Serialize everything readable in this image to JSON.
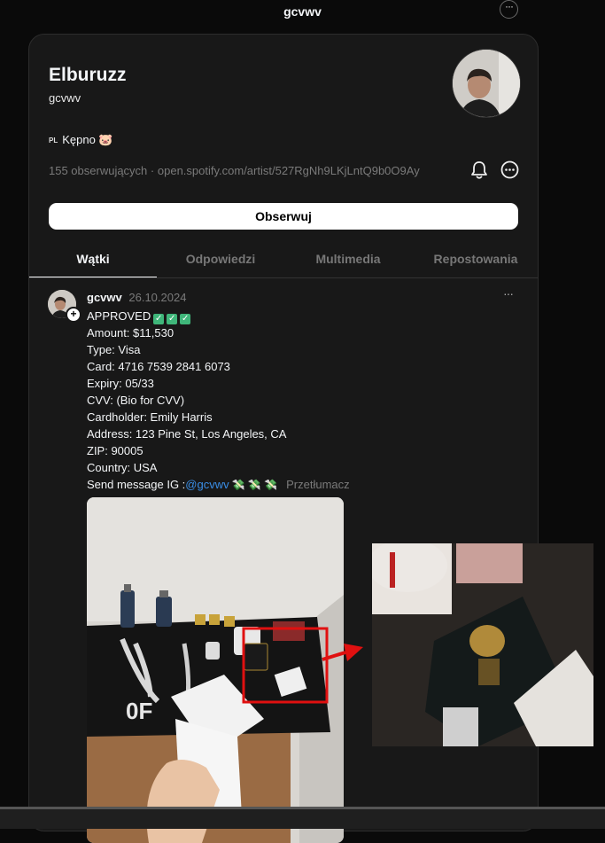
{
  "topbar": {
    "title": "gcvwv",
    "more": "···"
  },
  "profile": {
    "name": "Elburuzz",
    "handle": "gcvwv",
    "bio_flag": "PL",
    "bio_text": "Kępno 🐷",
    "followers": "155 obserwujących",
    "separator": "·",
    "link": "open.spotify.com/artist/527RgNh9LKjLntQ9b0O9Ay",
    "follow_label": "Obserwuj",
    "icons": [
      "bell-icon",
      "more-circle-icon"
    ]
  },
  "tabs": [
    {
      "label": "Wątki",
      "active": true
    },
    {
      "label": "Odpowiedzi",
      "active": false
    },
    {
      "label": "Multimedia",
      "active": false
    },
    {
      "label": "Repostowania",
      "active": false
    }
  ],
  "post": {
    "username": "gcvwv",
    "date": "26.10.2024",
    "more": "···",
    "plus": "+",
    "approved": "APPROVED",
    "check": "✓",
    "lines": [
      "Amount: $11,530",
      "Type: Visa",
      "Card: 4716 7539 2841 6073",
      "Expiry: 05/33",
      "CVV: (Bio for CVV)",
      "Cardholder: Emily Harris",
      "Address: 123 Pine St, Los Angeles, CA",
      "ZIP: 90005",
      "Country: USA"
    ],
    "send_prefix": "Send message IG :",
    "mention": "@gcvwv",
    "money": "💸 💸 💸",
    "translate": "Przetłumacz"
  },
  "colors": {
    "background": "#0a0a0a",
    "card": "#181818",
    "accent_link": "#3a8ee6",
    "highlight_box": "#e01010"
  }
}
